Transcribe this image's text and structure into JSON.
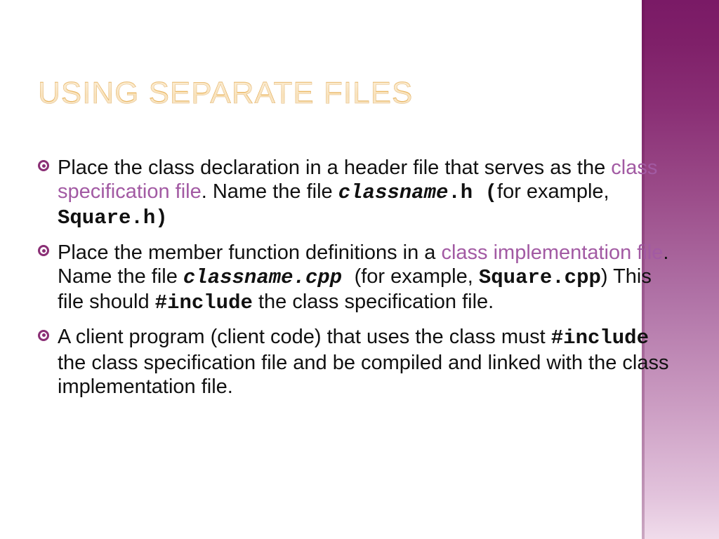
{
  "title": "USING SEPARATE FILES",
  "bullets": [
    {
      "p1": "Place the class declaration in a header file that serves as the ",
      "hl": "class specification file",
      "p2": ".  Name the file ",
      "c1": "classname",
      "c2": ".h  (",
      "p3": "for example, ",
      "c3": "Square.h",
      "c4": ")"
    },
    {
      "p1": "Place the member function definitions in a ",
      "hl": "class implementation file",
      "p2": ". Name the file ",
      "c1": "classname.cpp ",
      "p3": "(for example, ",
      "c2": "Square.cpp",
      "p4": ") This file should ",
      "c3": "#include",
      "p5": " the class specification file."
    },
    {
      "p1": "A client program (client code) that uses the class must ",
      "c1": "#include",
      "p2": " the class specification file and be compiled and linked with the class implementation file."
    }
  ]
}
